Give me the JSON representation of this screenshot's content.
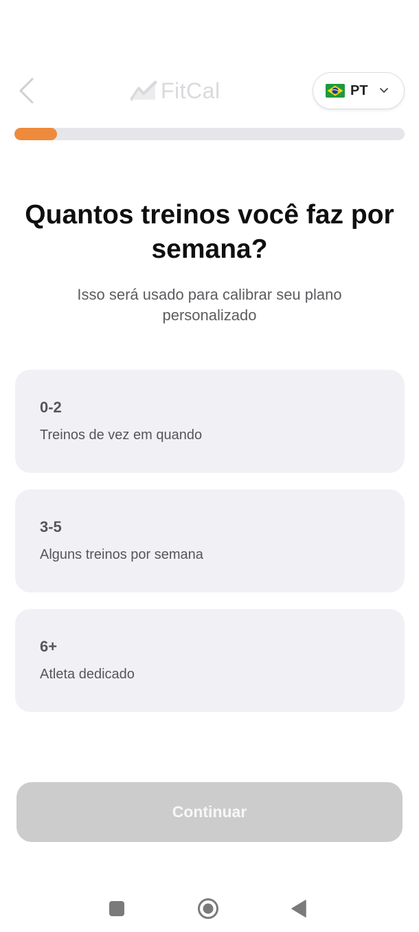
{
  "header": {
    "app_name": "FitCal",
    "language": {
      "flag_icon": "brazil-flag-icon",
      "code": "PT"
    }
  },
  "progress": {
    "fraction": 0.11,
    "color": "#ee8a3c"
  },
  "question": {
    "title": "Quantos treinos você faz por semana?",
    "subtitle": "Isso será usado para calibrar seu plano personalizado"
  },
  "options": [
    {
      "range": "0-2",
      "description": "Treinos de vez em quando"
    },
    {
      "range": "3-5",
      "description": "Alguns treinos por semana"
    },
    {
      "range": "6+",
      "description": "Atleta dedicado"
    }
  ],
  "footer": {
    "continue_label": "Continuar"
  },
  "system_nav": [
    "recent-apps-icon",
    "home-icon",
    "back-icon"
  ]
}
